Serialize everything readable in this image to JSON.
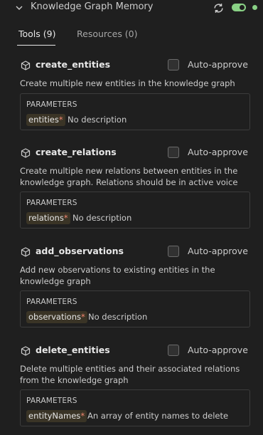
{
  "header": {
    "server_name": "Knowledge Graph Memory",
    "collapse_icon": "chevron-down-icon",
    "refresh_icon": "refresh-icon",
    "enabled": true,
    "status": "connected",
    "status_color": "#89d185"
  },
  "tabs": [
    {
      "label": "Tools (9)",
      "selected": true
    },
    {
      "label": "Resources (0)",
      "selected": false
    }
  ],
  "tools": [
    {
      "name": "create_entities",
      "auto_approve_label": "Auto-approve",
      "auto_approve": false,
      "description": "Create multiple new entities in the knowledge graph",
      "params_title": "PARAMETERS",
      "param_name": "entities",
      "required_mark": "*",
      "param_description": "No description"
    },
    {
      "name": "create_relations",
      "auto_approve_label": "Auto-approve",
      "auto_approve": false,
      "description": "Create multiple new relations between entities in the knowledge graph. Relations should be in active voice",
      "params_title": "PARAMETERS",
      "param_name": "relations",
      "required_mark": "*",
      "param_description": "No description"
    },
    {
      "name": "add_observations",
      "auto_approve_label": "Auto-approve",
      "auto_approve": false,
      "description": "Add new observations to existing entities in the knowledge graph",
      "params_title": "PARAMETERS",
      "param_name": "observations",
      "required_mark": "*",
      "param_description": "No description"
    },
    {
      "name": "delete_entities",
      "auto_approve_label": "Auto-approve",
      "auto_approve": false,
      "description": "Delete multiple entities and their associated relations from the knowledge graph",
      "params_title": "PARAMETERS",
      "param_name": "entityNames",
      "required_mark": "*",
      "param_description": "An array of entity names to delete"
    }
  ]
}
